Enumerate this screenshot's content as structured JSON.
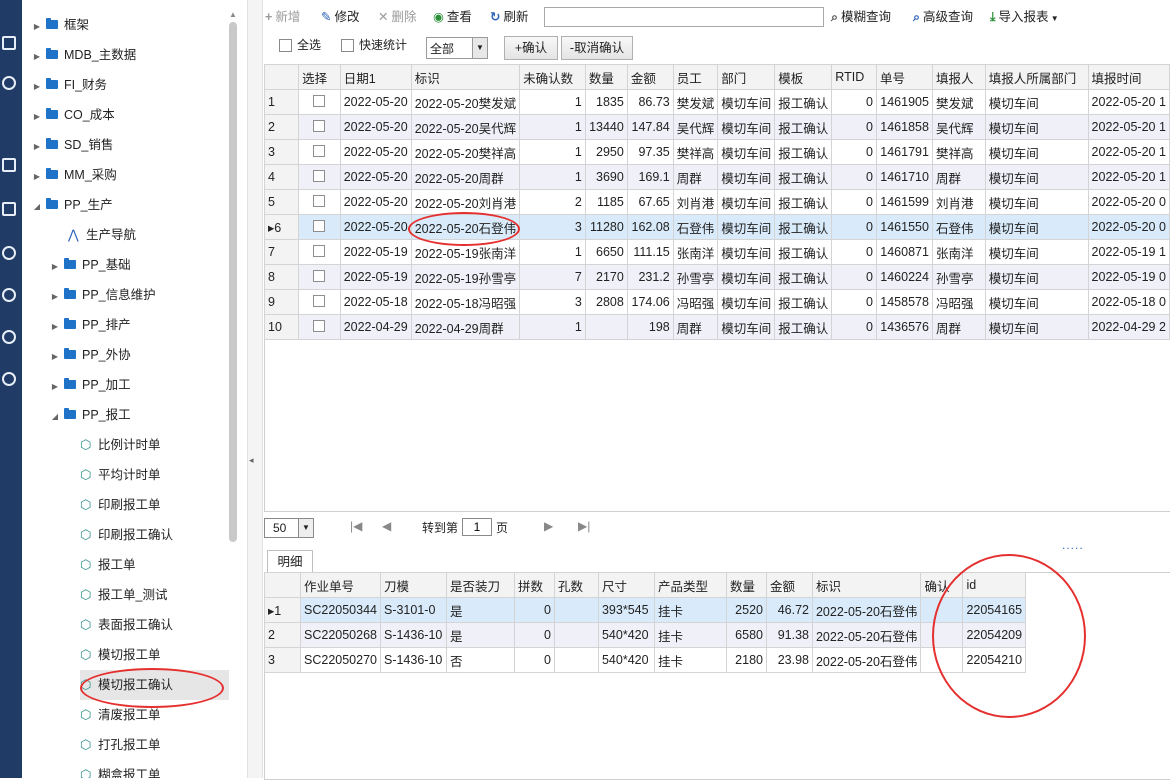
{
  "tree": {
    "items": [
      {
        "label": "框架",
        "type": "folder"
      },
      {
        "label": "MDB_主数据",
        "type": "folder"
      },
      {
        "label": "FI_财务",
        "type": "folder"
      },
      {
        "label": "CO_成本",
        "type": "folder"
      },
      {
        "label": "SD_销售",
        "type": "folder"
      },
      {
        "label": "MM_采购",
        "type": "folder"
      },
      {
        "label": "PP_生产",
        "type": "folder",
        "expanded": true
      },
      {
        "label": "生产导航",
        "type": "nav"
      },
      {
        "label": "PP_基础",
        "type": "folder"
      },
      {
        "label": "PP_信息维护",
        "type": "folder"
      },
      {
        "label": "PP_排产",
        "type": "folder"
      },
      {
        "label": "PP_外协",
        "type": "folder"
      },
      {
        "label": "PP_加工",
        "type": "folder"
      },
      {
        "label": "PP_报工",
        "type": "folder",
        "expanded": true
      },
      {
        "label": "比例计时单",
        "type": "leaf"
      },
      {
        "label": "平均计时单",
        "type": "leaf"
      },
      {
        "label": "印刷报工单",
        "type": "leaf"
      },
      {
        "label": "印刷报工确认",
        "type": "leaf"
      },
      {
        "label": "报工单",
        "type": "leaf"
      },
      {
        "label": "报工单_测试",
        "type": "leaf"
      },
      {
        "label": "表面报工确认",
        "type": "leaf"
      },
      {
        "label": "模切报工单",
        "type": "leaf"
      },
      {
        "label": "模切报工确认",
        "type": "leaf",
        "selected": true
      },
      {
        "label": "清废报工单",
        "type": "leaf"
      },
      {
        "label": "打孔报工单",
        "type": "leaf"
      },
      {
        "label": "糊盒报工单",
        "type": "leaf"
      }
    ]
  },
  "toolbar": {
    "add": "新增",
    "edit": "修改",
    "delete": "删除",
    "view": "查看",
    "refresh": "刷新",
    "search_value": "",
    "fuzzy": "模糊查询",
    "advanced": "高级查询",
    "export": "导入报表"
  },
  "filter": {
    "select_all": "全选",
    "quick_stats": "快速统计",
    "combo_value": "全部",
    "confirm": "+确认",
    "cancel_confirm": "-取消确认"
  },
  "main_grid": {
    "headers": [
      "",
      "选择",
      "日期1",
      "标识",
      "未确认数",
      "数量",
      "金额",
      "员工",
      "部门",
      "模板",
      "RTID",
      "单号",
      "填报人",
      "填报人所属部门",
      "填报时间"
    ],
    "rows": [
      [
        "1",
        "",
        "2022-05-20",
        "2022-05-20樊发斌",
        "1",
        "1835",
        "86.73",
        "樊发斌",
        "模切车间",
        "报工确认",
        "0",
        "1461905",
        "樊发斌",
        "模切车间",
        "2022-05-20 1"
      ],
      [
        "2",
        "",
        "2022-05-20",
        "2022-05-20吴代辉",
        "1",
        "13440",
        "147.84",
        "吴代辉",
        "模切车间",
        "报工确认",
        "0",
        "1461858",
        "吴代辉",
        "模切车间",
        "2022-05-20 1"
      ],
      [
        "3",
        "",
        "2022-05-20",
        "2022-05-20樊祥高",
        "1",
        "2950",
        "97.35",
        "樊祥高",
        "模切车间",
        "报工确认",
        "0",
        "1461791",
        "樊祥高",
        "模切车间",
        "2022-05-20 1"
      ],
      [
        "4",
        "",
        "2022-05-20",
        "2022-05-20周群",
        "1",
        "3690",
        "169.1",
        "周群",
        "模切车间",
        "报工确认",
        "0",
        "1461710",
        "周群",
        "模切车间",
        "2022-05-20 1"
      ],
      [
        "5",
        "",
        "2022-05-20",
        "2022-05-20刘肖港",
        "2",
        "1185",
        "67.65",
        "刘肖港",
        "模切车间",
        "报工确认",
        "0",
        "1461599",
        "刘肖港",
        "模切车间",
        "2022-05-20 0"
      ],
      [
        "▸6",
        "",
        "2022-05-20",
        "2022-05-20石登伟",
        "3",
        "11280",
        "162.08",
        "石登伟",
        "模切车间",
        "报工确认",
        "0",
        "1461550",
        "石登伟",
        "模切车间",
        "2022-05-20 0"
      ],
      [
        "7",
        "",
        "2022-05-19",
        "2022-05-19张南洋",
        "1",
        "6650",
        "111.15",
        "张南洋",
        "模切车间",
        "报工确认",
        "0",
        "1460871",
        "张南洋",
        "模切车间",
        "2022-05-19 1"
      ],
      [
        "8",
        "",
        "2022-05-19",
        "2022-05-19孙雪亭",
        "7",
        "2170",
        "231.2",
        "孙雪亭",
        "模切车间",
        "报工确认",
        "0",
        "1460224",
        "孙雪亭",
        "模切车间",
        "2022-05-19 0"
      ],
      [
        "9",
        "",
        "2022-05-18",
        "2022-05-18冯昭强",
        "3",
        "2808",
        "174.06",
        "冯昭强",
        "模切车间",
        "报工确认",
        "0",
        "1458578",
        "冯昭强",
        "模切车间",
        "2022-05-18 0"
      ],
      [
        "10",
        "",
        "2022-04-29",
        "2022-04-29周群",
        "1",
        "",
        "198",
        "周群",
        "模切车间",
        "报工确认",
        "0",
        "1436576",
        "周群",
        "模切车间",
        "2022-04-29 2"
      ]
    ],
    "selected_row": 5
  },
  "pager": {
    "page_size": "50",
    "goto_label": "转到第",
    "page": "1",
    "page_unit": "页",
    "more": "....."
  },
  "detail": {
    "tab": "明细",
    "headers": [
      "",
      "作业单号",
      "刀模",
      "是否装刀",
      "拼数",
      "孔数",
      "尺寸",
      "产品类型",
      "数量",
      "金额",
      "标识",
      "确认",
      "id"
    ],
    "rows": [
      [
        "▸1",
        "SC22050344",
        "S-3101-0",
        "是",
        "0",
        "",
        "393*545",
        "挂卡",
        "2520",
        "46.72",
        "2022-05-20石登伟",
        "",
        "22054165"
      ],
      [
        "2",
        "SC22050268",
        "S-1436-10",
        "是",
        "0",
        "",
        "540*420",
        "挂卡",
        "6580",
        "91.38",
        "2022-05-20石登伟",
        "",
        "22054209"
      ],
      [
        "3",
        "SC22050270",
        "S-1436-10",
        "否",
        "0",
        "",
        "540*420",
        "挂卡",
        "2180",
        "23.98",
        "2022-05-20石登伟",
        "",
        "22054210"
      ]
    ]
  }
}
